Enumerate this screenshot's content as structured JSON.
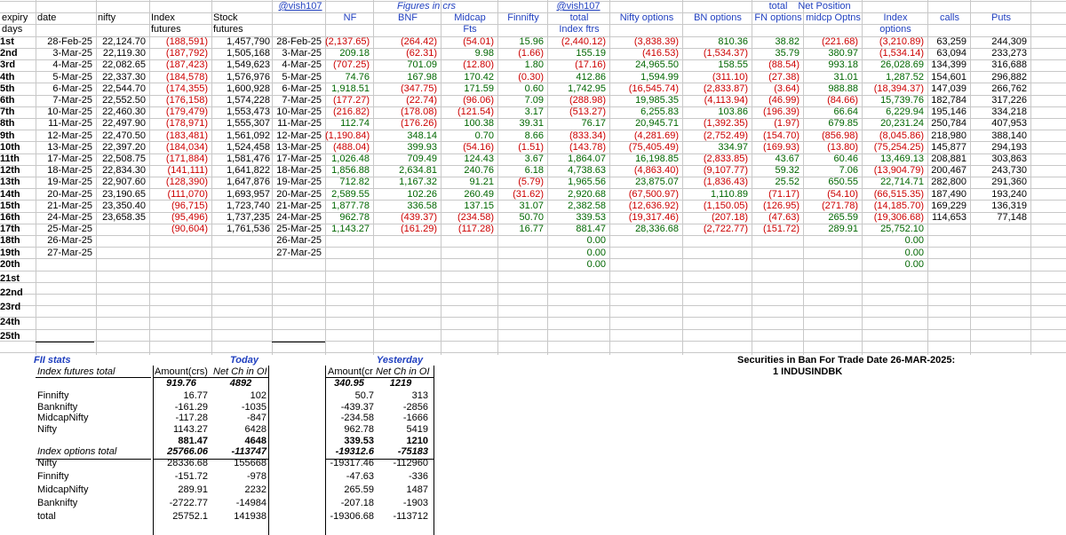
{
  "header": {
    "row0": {
      "vish1": "@vish107",
      "figures": "Figures in crs",
      "vish2": "@vish107",
      "total": "total",
      "netpos": "Net Position"
    },
    "row1": [
      "expiry",
      "date",
      "nifty",
      "Index",
      "Stock",
      "NF",
      "BNF",
      "Midcap",
      "Finnifty",
      "total",
      "Nifty options",
      "BN options",
      "FN options",
      "midcp Optns",
      "Index",
      "calls",
      "Puts"
    ],
    "row2": [
      "days",
      "futures",
      "futures",
      "Fts",
      "Index ftrs",
      "options"
    ]
  },
  "days": [
    "1st",
    "2nd",
    "3rd",
    "4th",
    "5th",
    "6th",
    "7th",
    "8th",
    "9th",
    "10th",
    "11th",
    "12th",
    "13th",
    "14th",
    "15th",
    "16th",
    "17th",
    "18th",
    "19th",
    "20th",
    "21st",
    "22nd",
    "23rd",
    "24th",
    "25th"
  ],
  "rows": [
    {
      "date": "28-Feb-25",
      "nifty": "22,124.70",
      "idxf": "(188,591)",
      "stkf": "1,457,790",
      "date2": "28-Feb-25",
      "nf": "(2,137.65)",
      "bnf": "(264.42)",
      "mid": "(54.01)",
      "fin": "15.96",
      "tot": "(2,440.12)",
      "nopt": "(3,838.39)",
      "bnopt": "810.36",
      "fnopt": "38.82",
      "midopt": "(221.68)",
      "idxopt": "(3,210.89)",
      "calls": "63,259",
      "puts": "244,309"
    },
    {
      "date": "3-Mar-25",
      "nifty": "22,119.30",
      "idxf": "(187,792)",
      "stkf": "1,505,168",
      "date2": "3-Mar-25",
      "nf": "209.18",
      "bnf": "(62.31)",
      "mid": "9.98",
      "fin": "(1.66)",
      "tot": "155.19",
      "nopt": "(416.53)",
      "bnopt": "(1,534.37)",
      "fnopt": "35.79",
      "midopt": "380.97",
      "idxopt": "(1,534.14)",
      "calls": "63,094",
      "puts": "233,273"
    },
    {
      "date": "4-Mar-25",
      "nifty": "22,082.65",
      "idxf": "(187,423)",
      "stkf": "1,549,623",
      "date2": "4-Mar-25",
      "nf": "(707.25)",
      "bnf": "701.09",
      "mid": "(12.80)",
      "fin": "1.80",
      "tot": "(17.16)",
      "nopt": "24,965.50",
      "bnopt": "158.55",
      "fnopt": "(88.54)",
      "midopt": "993.18",
      "idxopt": "26,028.69",
      "calls": "134,399",
      "puts": "316,688"
    },
    {
      "date": "5-Mar-25",
      "nifty": "22,337.30",
      "idxf": "(184,578)",
      "stkf": "1,576,976",
      "date2": "5-Mar-25",
      "nf": "74.76",
      "bnf": "167.98",
      "mid": "170.42",
      "fin": "(0.30)",
      "tot": "412.86",
      "nopt": "1,594.99",
      "bnopt": "(311.10)",
      "fnopt": "(27.38)",
      "midopt": "31.01",
      "idxopt": "1,287.52",
      "calls": "154,601",
      "puts": "296,882"
    },
    {
      "date": "6-Mar-25",
      "nifty": "22,544.70",
      "idxf": "(174,355)",
      "stkf": "1,600,928",
      "date2": "6-Mar-25",
      "nf": "1,918.51",
      "bnf": "(347.75)",
      "mid": "171.59",
      "fin": "0.60",
      "tot": "1,742.95",
      "nopt": "(16,545.74)",
      "bnopt": "(2,833.87)",
      "fnopt": "(3.64)",
      "midopt": "988.88",
      "idxopt": "(18,394.37)",
      "calls": "147,039",
      "puts": "266,762"
    },
    {
      "date": "7-Mar-25",
      "nifty": "22,552.50",
      "idxf": "(176,158)",
      "stkf": "1,574,228",
      "date2": "7-Mar-25",
      "nf": "(177.27)",
      "bnf": "(22.74)",
      "mid": "(96.06)",
      "fin": "7.09",
      "tot": "(288.98)",
      "nopt": "19,985.35",
      "bnopt": "(4,113.94)",
      "fnopt": "(46.99)",
      "midopt": "(84.66)",
      "idxopt": "15,739.76",
      "calls": "182,784",
      "puts": "317,226"
    },
    {
      "date": "10-Mar-25",
      "nifty": "22,460.30",
      "idxf": "(179,479)",
      "stkf": "1,553,473",
      "date2": "10-Mar-25",
      "nf": "(216.82)",
      "bnf": "(178.08)",
      "mid": "(121.54)",
      "fin": "3.17",
      "tot": "(513.27)",
      "nopt": "6,255.83",
      "bnopt": "103.86",
      "fnopt": "(196.39)",
      "midopt": "66.64",
      "idxopt": "6,229.94",
      "calls": "195,146",
      "puts": "334,218"
    },
    {
      "date": "11-Mar-25",
      "nifty": "22,497.90",
      "idxf": "(178,971)",
      "stkf": "1,555,307",
      "date2": "11-Mar-25",
      "nf": "112.74",
      "bnf": "(176.26)",
      "mid": "100.38",
      "fin": "39.31",
      "tot": "76.17",
      "nopt": "20,945.71",
      "bnopt": "(1,392.35)",
      "fnopt": "(1.97)",
      "midopt": "679.85",
      "idxopt": "20,231.24",
      "calls": "250,784",
      "puts": "407,953"
    },
    {
      "date": "12-Mar-25",
      "nifty": "22,470.50",
      "idxf": "(183,481)",
      "stkf": "1,561,092",
      "date2": "12-Mar-25",
      "nf": "(1,190.84)",
      "bnf": "348.14",
      "mid": "0.70",
      "fin": "8.66",
      "tot": "(833.34)",
      "nopt": "(4,281.69)",
      "bnopt": "(2,752.49)",
      "fnopt": "(154.70)",
      "midopt": "(856.98)",
      "idxopt": "(8,045.86)",
      "calls": "218,980",
      "puts": "388,140"
    },
    {
      "date": "13-Mar-25",
      "nifty": "22,397.20",
      "idxf": "(184,034)",
      "stkf": "1,524,458",
      "date2": "13-Mar-25",
      "nf": "(488.04)",
      "bnf": "399.93",
      "mid": "(54.16)",
      "fin": "(1.51)",
      "tot": "(143.78)",
      "nopt": "(75,405.49)",
      "bnopt": "334.97",
      "fnopt": "(169.93)",
      "midopt": "(13.80)",
      "idxopt": "(75,254.25)",
      "calls": "145,877",
      "puts": "294,193"
    },
    {
      "date": "17-Mar-25",
      "nifty": "22,508.75",
      "idxf": "(171,884)",
      "stkf": "1,581,476",
      "date2": "17-Mar-25",
      "nf": "1,026.48",
      "bnf": "709.49",
      "mid": "124.43",
      "fin": "3.67",
      "tot": "1,864.07",
      "nopt": "16,198.85",
      "bnopt": "(2,833.85)",
      "fnopt": "43.67",
      "midopt": "60.46",
      "idxopt": "13,469.13",
      "calls": "208,881",
      "puts": "303,863"
    },
    {
      "date": "18-Mar-25",
      "nifty": "22,834.30",
      "idxf": "(141,111)",
      "stkf": "1,641,822",
      "date2": "18-Mar-25",
      "nf": "1,856.88",
      "bnf": "2,634.81",
      "mid": "240.76",
      "fin": "6.18",
      "tot": "4,738.63",
      "nopt": "(4,863.40)",
      "bnopt": "(9,107.77)",
      "fnopt": "59.32",
      "midopt": "7.06",
      "idxopt": "(13,904.79)",
      "calls": "200,467",
      "puts": "243,730"
    },
    {
      "date": "19-Mar-25",
      "nifty": "22,907.60",
      "idxf": "(128,390)",
      "stkf": "1,647,876",
      "date2": "19-Mar-25",
      "nf": "712.82",
      "bnf": "1,167.32",
      "mid": "91.21",
      "fin": "(5.79)",
      "tot": "1,965.56",
      "nopt": "23,875.07",
      "bnopt": "(1,836.43)",
      "fnopt": "25.52",
      "midopt": "650.55",
      "idxopt": "22,714.71",
      "calls": "282,800",
      "puts": "291,360"
    },
    {
      "date": "20-Mar-25",
      "nifty": "23,190.65",
      "idxf": "(111,070)",
      "stkf": "1,693,957",
      "date2": "20-Mar-25",
      "nf": "2,589.55",
      "bnf": "102.26",
      "mid": "260.49",
      "fin": "(31.62)",
      "tot": "2,920.68",
      "nopt": "(67,500.97)",
      "bnopt": "1,110.89",
      "fnopt": "(71.17)",
      "midopt": "(54.10)",
      "idxopt": "(66,515.35)",
      "calls": "187,490",
      "puts": "193,240"
    },
    {
      "date": "21-Mar-25",
      "nifty": "23,350.40",
      "idxf": "(96,715)",
      "stkf": "1,723,740",
      "date2": "21-Mar-25",
      "nf": "1,877.78",
      "bnf": "336.58",
      "mid": "137.15",
      "fin": "31.07",
      "tot": "2,382.58",
      "nopt": "(12,636.92)",
      "bnopt": "(1,150.05)",
      "fnopt": "(126.95)",
      "midopt": "(271.78)",
      "idxopt": "(14,185.70)",
      "calls": "169,229",
      "puts": "136,319"
    },
    {
      "date": "24-Mar-25",
      "nifty": "23,658.35",
      "idxf": "(95,496)",
      "stkf": "1,737,235",
      "date2": "24-Mar-25",
      "nf": "962.78",
      "bnf": "(439.37)",
      "mid": "(234.58)",
      "fin": "50.70",
      "tot": "339.53",
      "nopt": "(19,317.46)",
      "bnopt": "(207.18)",
      "fnopt": "(47.63)",
      "midopt": "265.59",
      "idxopt": "(19,306.68)",
      "calls": "114,653",
      "puts": "77,148"
    },
    {
      "date": "25-Mar-25",
      "nifty": "",
      "idxf": "(90,604)",
      "stkf": "1,761,536",
      "date2": "25-Mar-25",
      "nf": "1,143.27",
      "bnf": "(161.29)",
      "mid": "(117.28)",
      "fin": "16.77",
      "tot": "881.47",
      "nopt": "28,336.68",
      "bnopt": "(2,722.77)",
      "fnopt": "(151.72)",
      "midopt": "289.91",
      "idxopt": "25,752.10",
      "calls": "",
      "puts": ""
    },
    {
      "date": "26-Mar-25",
      "nifty": "",
      "idxf": "",
      "stkf": "",
      "date2": "26-Mar-25",
      "nf": "",
      "bnf": "",
      "mid": "",
      "fin": "",
      "tot": "0.00",
      "nopt": "",
      "bnopt": "",
      "fnopt": "",
      "midopt": "",
      "idxopt": "0.00",
      "calls": "",
      "puts": ""
    },
    {
      "date": "27-Mar-25",
      "nifty": "",
      "idxf": "",
      "stkf": "",
      "date2": "27-Mar-25",
      "nf": "",
      "bnf": "",
      "mid": "",
      "fin": "",
      "tot": "0.00",
      "nopt": "",
      "bnopt": "",
      "fnopt": "",
      "midopt": "",
      "idxopt": "0.00",
      "calls": "",
      "puts": ""
    },
    {
      "date": "",
      "nifty": "",
      "idxf": "",
      "stkf": "",
      "date2": "",
      "nf": "",
      "bnf": "",
      "mid": "",
      "fin": "",
      "tot": "0.00",
      "nopt": "",
      "bnopt": "",
      "fnopt": "",
      "midopt": "",
      "idxopt": "0.00",
      "calls": "",
      "puts": ""
    }
  ],
  "fii": {
    "title": "FII stats",
    "today": "Today",
    "yesterday": "Yesterday",
    "idx_fut_total": "Index futures total",
    "col_amt": "Amount(crs)",
    "col_oi": "Net Ch in OI",
    "col_amt_y": "Amount(cr",
    "col_oi_y": "Net Ch in OI",
    "futures_total": {
      "amt": "919.76",
      "oi": "4892",
      "amt_y": "340.95",
      "oi_y": "1219"
    },
    "futures": [
      {
        "name": "Finnifty",
        "amt": "16.77",
        "oi": "102",
        "amt_y": "50.7",
        "oi_y": "313"
      },
      {
        "name": "Banknifty",
        "amt": "-161.29",
        "oi": "-1035",
        "amt_y": "-439.37",
        "oi_y": "-2856"
      },
      {
        "name": "MidcapNifty",
        "amt": "-117.28",
        "oi": "-847",
        "amt_y": "-234.58",
        "oi_y": "-1666"
      },
      {
        "name": "Nifty",
        "amt": "1143.27",
        "oi": "6428",
        "amt_y": "962.78",
        "oi_y": "5419"
      }
    ],
    "futures_sum": {
      "amt": "881.47",
      "oi": "4648",
      "amt_y": "339.53",
      "oi_y": "1210"
    },
    "idx_opt_total": "Index options total",
    "options_total": {
      "amt": "25766.06",
      "oi": "-113747",
      "amt_y": "-19312.6",
      "oi_y": "-75183"
    },
    "options": [
      {
        "name": "Nifty",
        "amt": "28336.68",
        "oi": "155668",
        "amt_y": "-19317.46",
        "oi_y": "-112960"
      },
      {
        "name": "Finnifty",
        "amt": "-151.72",
        "oi": "-978",
        "amt_y": "-47.63",
        "oi_y": "-336"
      },
      {
        "name": "MidcapNifty",
        "amt": "289.91",
        "oi": "2232",
        "amt_y": "265.59",
        "oi_y": "1487"
      },
      {
        "name": "Banknifty",
        "amt": "-2722.77",
        "oi": "-14984",
        "amt_y": "-207.18",
        "oi_y": "-1903"
      },
      {
        "name": "total",
        "amt": "25752.1",
        "oi": "141938",
        "amt_y": "-19306.68",
        "oi_y": "-113712"
      }
    ]
  },
  "ban": {
    "title": "Securities in Ban For Trade Date 26-MAR-2025:",
    "item": "1 INDUSINDBK"
  }
}
